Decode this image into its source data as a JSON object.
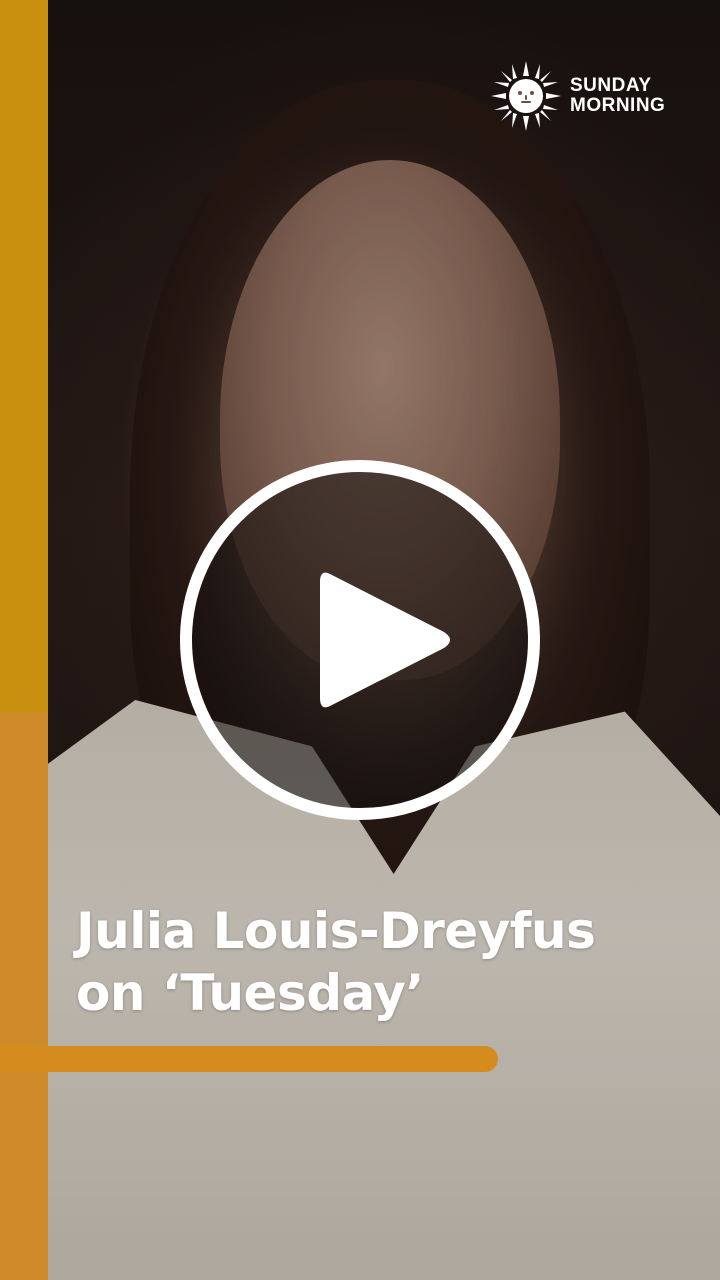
{
  "brand": {
    "line1": "SUNDAY",
    "line2": "MORNING",
    "logo_icon": "sun-icon",
    "accent_color": "#c8900e"
  },
  "video": {
    "play_icon": "play-icon"
  },
  "headline": {
    "line1": "Julia Louis-Dreyfus",
    "line2": "on ‘Tuesday’"
  },
  "colors": {
    "left_bar": "#c8900e",
    "underline_bar": "#d68b1e",
    "lower_panel": "#cf8a2a"
  }
}
